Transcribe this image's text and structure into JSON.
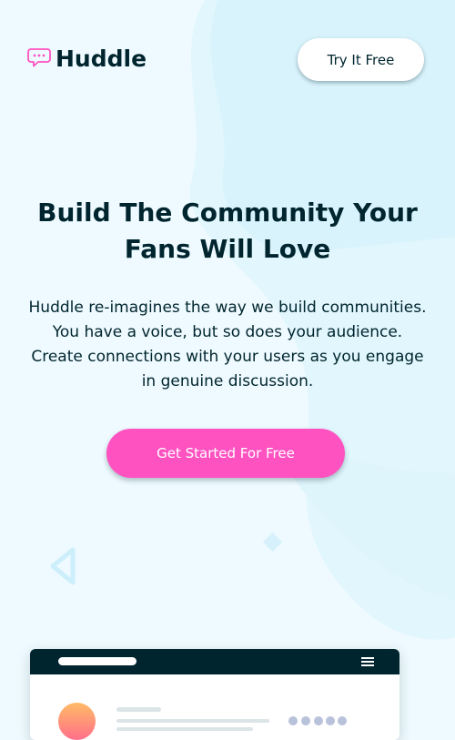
{
  "brand": {
    "name": "Huddle",
    "logo_icon": "speech-bubble-icon",
    "accent_color": "#ff52c1",
    "dark_color": "#00252e"
  },
  "header": {
    "try_button_label": "Try It Free"
  },
  "hero": {
    "title": "Build The Community Your Fans Will Love",
    "description": "Huddle re-imagines the way we build communities. You have a voice, but so does your audience. Create connections with your users as you engage in genuine discussion.",
    "cta_label": "Get Started For Free"
  },
  "mockup": {
    "menu_icon": "hamburger-menu-icon"
  }
}
